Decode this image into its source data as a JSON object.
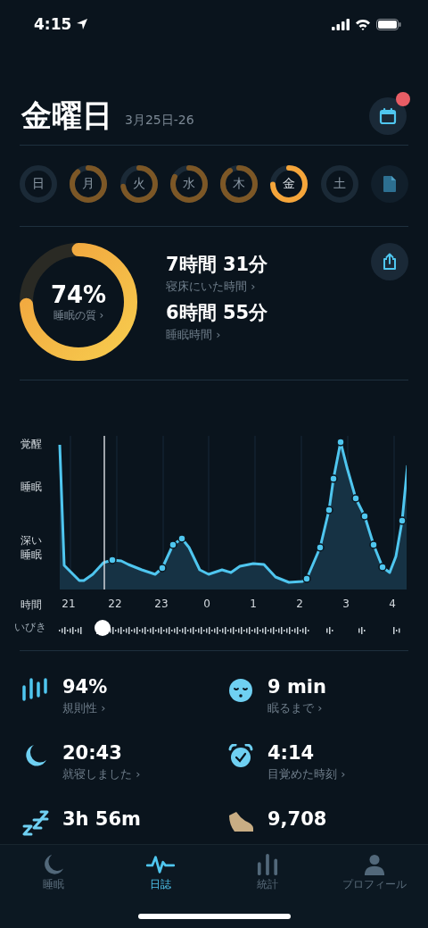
{
  "status_bar": {
    "time": "4:15"
  },
  "header": {
    "title": "金曜日",
    "date_range": "3月25日-26",
    "calendar_notification": true
  },
  "days": [
    {
      "label": "日",
      "selected": false
    },
    {
      "label": "月",
      "level": 0.88,
      "selected": false
    },
    {
      "label": "火",
      "level": 0.72,
      "selected": false
    },
    {
      "label": "水",
      "level": 0.82,
      "selected": false
    },
    {
      "label": "木",
      "level": 0.9,
      "selected": false
    },
    {
      "label": "金",
      "level": 0.74,
      "selected": true
    },
    {
      "label": "土",
      "selected": false
    }
  ],
  "summary": {
    "quality": {
      "value": "74%",
      "label": "睡眠の質 ›",
      "level": 0.74
    },
    "metrics": [
      {
        "value": "7時間 31分",
        "label": "寝床にいた時間 ›"
      },
      {
        "value": "6時間 55分",
        "label": "睡眠時間 ›"
      }
    ]
  },
  "hypnogram": {
    "y_labels": [
      "覚醒",
      "睡眠",
      "深い睡眠"
    ],
    "x_title": "時間",
    "x_labels": [
      "21",
      "22",
      "23",
      "0",
      "1",
      "2",
      "3",
      "4"
    ],
    "snore_label": "いびき"
  },
  "stats": [
    {
      "kind": "regularity",
      "value": "94%",
      "label": "規則性 ›"
    },
    {
      "kind": "fall-asleep",
      "value": "9 min",
      "label": "眠るまで ›"
    },
    {
      "kind": "bedtime",
      "value": "20:43",
      "label": "就寝しました ›"
    },
    {
      "kind": "wake",
      "value": "4:14",
      "label": "目覚めた時刻 ›"
    },
    {
      "kind": "snore",
      "value": "3h 56m"
    },
    {
      "kind": "steps",
      "value": "9,708"
    }
  ],
  "tabs": [
    {
      "kind": "sleep",
      "label": "睡眠",
      "selected": false
    },
    {
      "kind": "journal",
      "label": "日誌",
      "selected": true
    },
    {
      "kind": "stats",
      "label": "統計",
      "selected": false
    },
    {
      "kind": "profile",
      "label": "プロフィール",
      "selected": false
    }
  ]
}
